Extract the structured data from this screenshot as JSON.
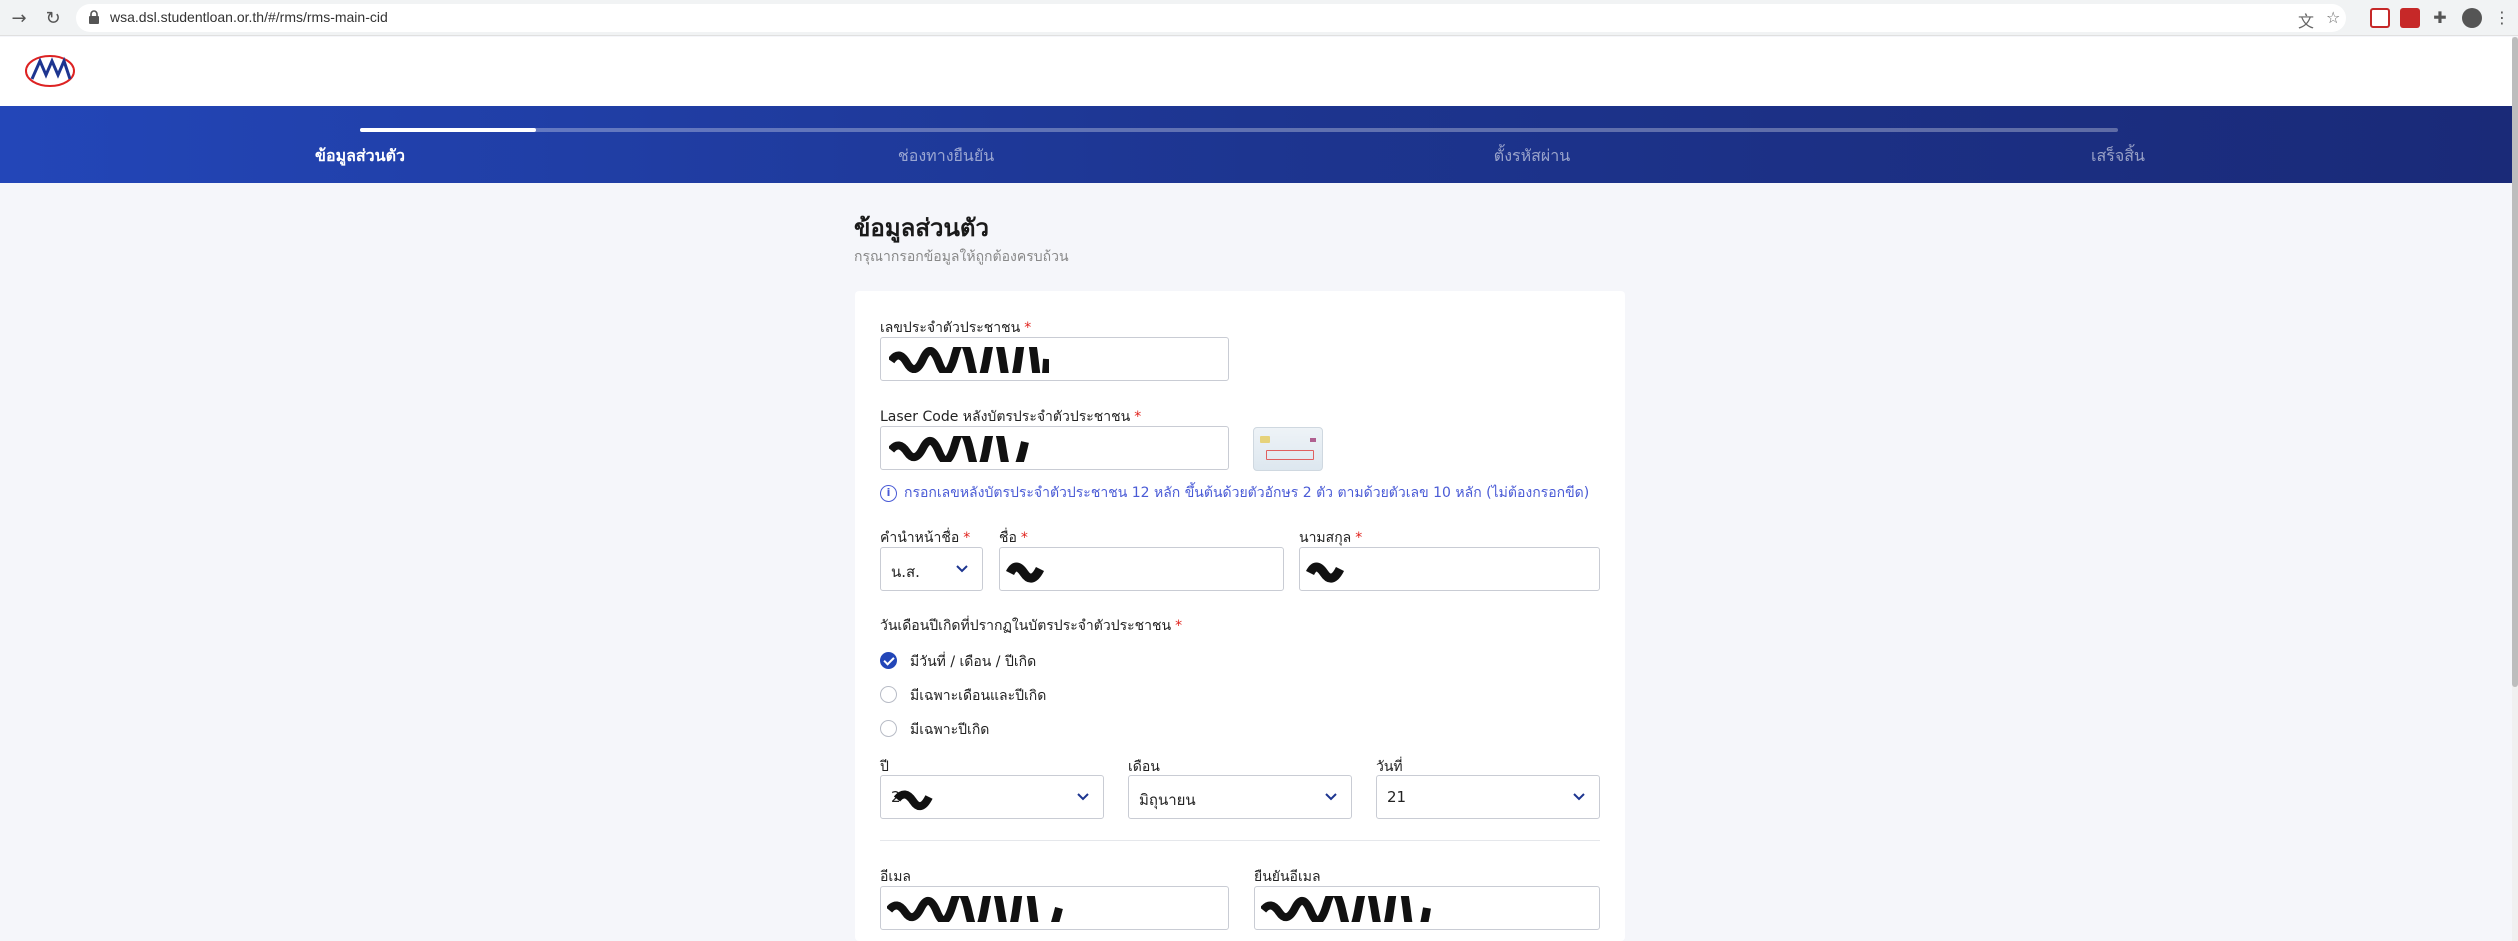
{
  "browser": {
    "url": "wsa.dsl.studentloan.or.th/#/rms/rms-main-cid"
  },
  "steps": [
    {
      "label": "ข้อมูลส่วนตัว",
      "active": true
    },
    {
      "label": "ช่องทางยืนยัน",
      "active": false
    },
    {
      "label": "ตั้งรหัสผ่าน",
      "active": false
    },
    {
      "label": "เสร็จสิ้น",
      "active": false
    }
  ],
  "page": {
    "title": "ข้อมูลส่วนตัว",
    "subtitle": "กรุณากรอกข้อมูลให้ถูกต้องครบถ้วน"
  },
  "form": {
    "citizen_id": {
      "label": "เลขประจำตัวประชาชน",
      "required": "*"
    },
    "laser_code": {
      "label": "Laser Code หลังบัตรประจำตัวประชาชน",
      "required": "*",
      "hint": "กรอกเลขหลังบัตรประจำตัวประชาชน 12 หลัก ขึ้นต้นด้วยตัวอักษร 2 ตัว ตามด้วยตัวเลข 10 หลัก (ไม่ต้องกรอกขีด)"
    },
    "prefix": {
      "label": "คำนำหน้าชื่อ",
      "required": "*",
      "value": "น.ส."
    },
    "first_name": {
      "label": "ชื่อ",
      "required": "*"
    },
    "last_name": {
      "label": "นามสกุล",
      "required": "*"
    },
    "birth_type": {
      "label": "วันเดือนปีเกิดที่ปรากฏในบัตรประจำตัวประชาชน",
      "required": "*",
      "options": [
        {
          "label": "มีวันที่ / เดือน / ปีเกิด",
          "selected": true
        },
        {
          "label": "มีเฉพาะเดือนและปีเกิด",
          "selected": false
        },
        {
          "label": "มีเฉพาะปีเกิด",
          "selected": false
        }
      ]
    },
    "year": {
      "label": "ปี",
      "value": "2"
    },
    "month": {
      "label": "เดือน",
      "value": "มิถุนายน"
    },
    "day": {
      "label": "วันที่",
      "value": "21"
    },
    "email": {
      "label": "อีเมล"
    },
    "email_confirm": {
      "label": "ยืนยันอีเมล"
    }
  }
}
